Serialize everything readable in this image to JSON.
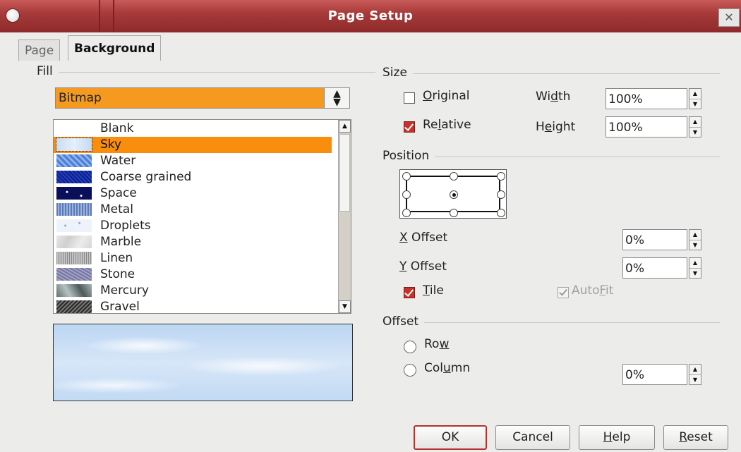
{
  "window": {
    "title": "Page Setup",
    "close_glyph": "✕",
    "colors": {
      "titlebar": "#a83a3a",
      "selection": "#f88d0e",
      "checkbox_on": "#c8302a"
    }
  },
  "tabs": [
    {
      "label": "Page",
      "active": false
    },
    {
      "label": "Background",
      "active": true
    }
  ],
  "fill": {
    "section_label": "Fill",
    "dropdown_value": "Bitmap",
    "bitmaps": [
      {
        "label": "Blank",
        "selected": false
      },
      {
        "label": "Sky",
        "selected": true
      },
      {
        "label": "Water",
        "selected": false
      },
      {
        "label": "Coarse grained",
        "selected": false
      },
      {
        "label": "Space",
        "selected": false
      },
      {
        "label": "Metal",
        "selected": false
      },
      {
        "label": "Droplets",
        "selected": false
      },
      {
        "label": "Marble",
        "selected": false
      },
      {
        "label": "Linen",
        "selected": false
      },
      {
        "label": "Stone",
        "selected": false
      },
      {
        "label": "Mercury",
        "selected": false
      },
      {
        "label": "Gravel",
        "selected": false
      }
    ]
  },
  "size": {
    "section_label": "Size",
    "original_label": "Original",
    "original_checked": false,
    "relative_label": "Relative",
    "relative_checked": true,
    "width_label": "Width",
    "width_value": "100%",
    "height_label": "Height",
    "height_value": "100%"
  },
  "position": {
    "section_label": "Position",
    "selected_point": "center",
    "x_offset_label": "X Offset",
    "x_offset_value": "0%",
    "y_offset_label": "Y Offset",
    "y_offset_value": "0%",
    "tile_label": "Tile",
    "tile_checked": true,
    "autofit_label": "AutoFit",
    "autofit_checked": true,
    "autofit_enabled": false
  },
  "offset": {
    "section_label": "Offset",
    "row_label": "Row",
    "column_label": "Column",
    "value": "0%"
  },
  "buttons": {
    "ok": "OK",
    "cancel": "Cancel",
    "help": "Help",
    "reset": "Reset"
  }
}
